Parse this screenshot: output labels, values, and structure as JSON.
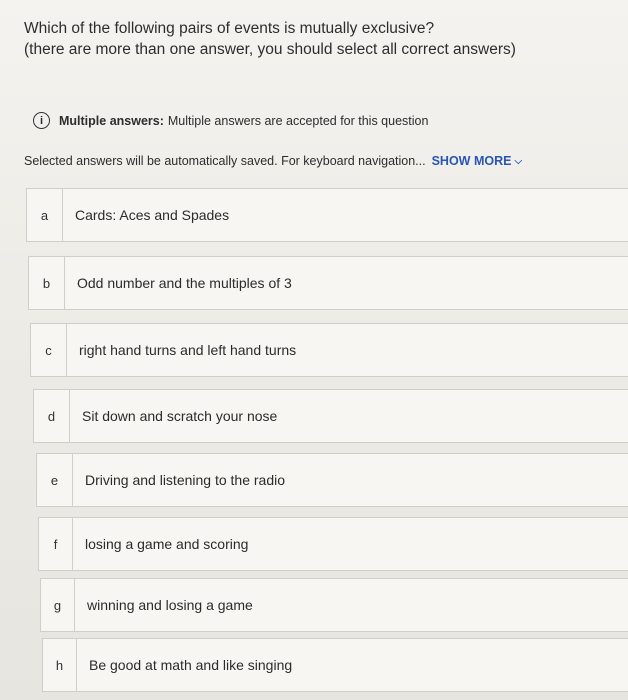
{
  "question": {
    "line1": "Which of the following pairs of events is mutually exclusive?",
    "line2": "(there are more than one answer, you should select all correct answers)"
  },
  "info": {
    "icon": "info-icon",
    "title": "Multiple answers:",
    "text": "Multiple answers are accepted for this question"
  },
  "autosave": {
    "text": "Selected answers will be automatically saved. For keyboard navigation...",
    "show_more": "SHOW MORE",
    "chevron_icon": "chevron-down-icon"
  },
  "options": [
    {
      "letter": "a",
      "text": "Cards: Aces and Spades"
    },
    {
      "letter": "b",
      "text": "Odd number and the multiples of 3"
    },
    {
      "letter": "c",
      "text": "right hand turns and left hand turns"
    },
    {
      "letter": "d",
      "text": "Sit down and scratch your nose"
    },
    {
      "letter": "e",
      "text": "Driving and listening to the radio"
    },
    {
      "letter": "f",
      "text": "losing a game and scoring"
    },
    {
      "letter": "g",
      "text": "winning and losing a game"
    },
    {
      "letter": "h",
      "text": "Be good at math and like singing"
    }
  ]
}
